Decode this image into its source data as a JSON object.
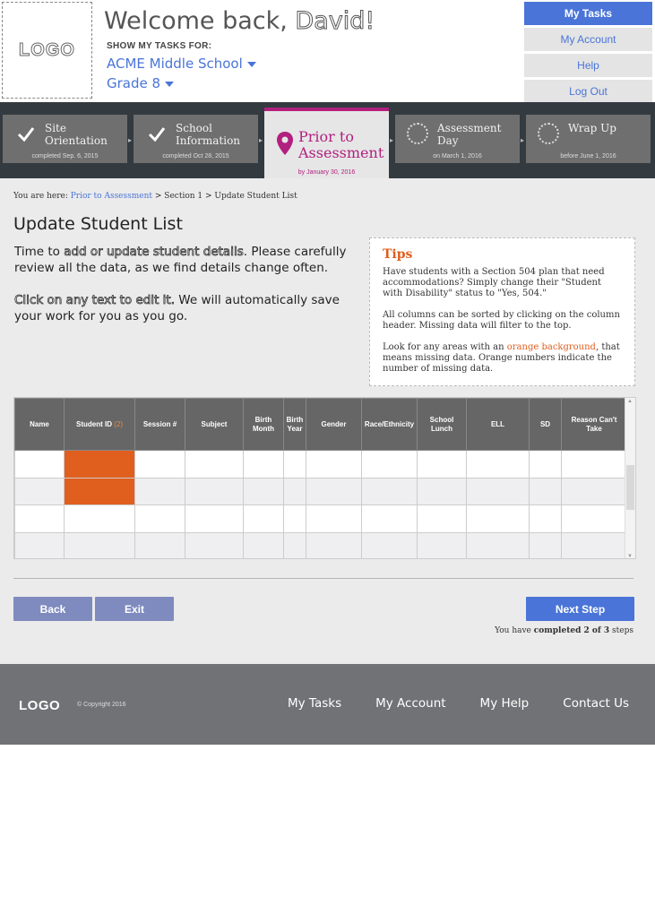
{
  "header": {
    "logo_text": "LOGO",
    "welcome_prefix": "Welcome back, ",
    "user_name": "David!",
    "show_tasks_label": "SHOW MY TASKS FOR:",
    "school": "ACME Middle School",
    "grade": "Grade 8"
  },
  "topnav": {
    "items": [
      "My Tasks",
      "My Account",
      "Help",
      "Log Out"
    ],
    "active": "My Tasks"
  },
  "steps": [
    {
      "title_line1": "Site",
      "title_line2": "Orientation",
      "sub": "completed Sep. 6, 2015",
      "status": "complete",
      "icon": "check-icon"
    },
    {
      "title_line1": "School",
      "title_line2": "Information",
      "sub": "completed Oct 28, 2015",
      "status": "complete",
      "icon": "check-icon"
    },
    {
      "title_line1": "Prior to",
      "title_line2": "Assessment",
      "sub": "by January 30, 2016",
      "status": "current",
      "icon": "location-pin-icon"
    },
    {
      "title_line1": "Assessment",
      "title_line2": "Day",
      "sub": "on March 1, 2016",
      "status": "upcoming",
      "icon": "dotted-circle-icon"
    },
    {
      "title_line1": "Wrap Up",
      "title_line2": "",
      "sub": "before June 1, 2016",
      "status": "upcoming",
      "icon": "dotted-circle-icon"
    }
  ],
  "breadcrumb": {
    "prefix": "You are here: ",
    "link": "Prior to Assessment",
    "rest": " > Section 1 > Update Student List"
  },
  "page": {
    "title": "Update Student List",
    "intro1_highlight_a": "Time to ",
    "intro1_outline": "add or update student details",
    "intro1_rest": ". Please carefully review all the data, as we find details change often.",
    "intro2_outline": "Click on any text to edit it.",
    "intro2_rest": " We will automatically save your work for you as you go."
  },
  "tips": {
    "heading": "Tips",
    "p1": "Have students with a Section 504 plan that need accommodations? Simply change their \"Student with Disability\" status to \"Yes, 504.\"",
    "p2": "All columns can be sorted by clicking on the column header. Missing data will filter to the top.",
    "p3_before": "Look for any areas with an ",
    "p3_orange": "orange background",
    "p3_after": ", that means missing data. Orange numbers indicate the number of missing data."
  },
  "table": {
    "columns": [
      {
        "label": "Name"
      },
      {
        "label": "Student ID",
        "missing_count": "(2)"
      },
      {
        "label": "Session #"
      },
      {
        "label": "Subject"
      },
      {
        "label": "Birth Month"
      },
      {
        "label": "Birth Year"
      },
      {
        "label": "Gender"
      },
      {
        "label": "Race/Ethnicity"
      },
      {
        "label": "School Lunch"
      },
      {
        "label": "ELL"
      },
      {
        "label": "SD"
      },
      {
        "label": "Reason Can't Take"
      }
    ],
    "rows": 4,
    "missing_cells": [
      [
        0,
        1
      ],
      [
        1,
        1
      ]
    ],
    "missing_color": "#e05e1e"
  },
  "actions": {
    "back": "Back",
    "exit": "Exit",
    "next": "Next Step",
    "progress_prefix": "You have ",
    "progress_word": "completed",
    "progress_count": " 2 of 3",
    "progress_suffix": " steps"
  },
  "footer": {
    "logo_text": "LOGO",
    "copyright": "© Copyright 2016",
    "links": [
      "My Tasks",
      "My Account",
      "My Help",
      "Contact Us"
    ]
  },
  "colors": {
    "accent": "#4a74d8",
    "current_step": "#b1207f",
    "missing": "#e05e1e"
  }
}
